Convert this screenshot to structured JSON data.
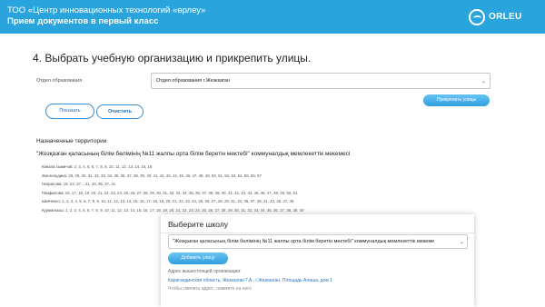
{
  "header": {
    "org": "ТОО «Центр инновационных технологий «өрлеу»",
    "subtitle": "Прием документов в первый класс",
    "logo_text": "ORLEU",
    "logo_icon": "orleu-logo-icon"
  },
  "step": {
    "title": "4. Выбрать учебную организацию и прикрепить улицы."
  },
  "form": {
    "edu_label": "Отдел образования",
    "edu_value": "Отдел образования г.Жезказган",
    "attach_button": "Прикрепить улицы",
    "show_button": "Показать",
    "clear_button": "Очистить"
  },
  "assigned": {
    "heading": "Назначенные территории",
    "school": "\"Жезқазған қаласының білім бөлімінің №11 жалпы орта білім беретін мектебі\" коммуналдық мемлекеттік мекемесі",
    "streets": [
      {
        "name": "Канала сымичов:",
        "numbers": "2, 3, 4, 5, 6, 7, 8, 9, 10, 11, 12, 13, 14, 15, 16"
      },
      {
        "name": "Жангельдина:",
        "numbers": "28, 29, 30, 31, 32, 33, 34, 35, 36, 37, 38, 39, 40, 41, 42, 43, 44, 45, 46, 47, 48, 49, 50, 51, 52, 53, 54, 55, 56, 57"
      },
      {
        "name": "Некрасова:",
        "numbers": "15, 22, 27, , 31, 33, 35, 37, 41"
      },
      {
        "name": "Панфилова:",
        "numbers": "16, 17, 18, 19, 20, 21, 22, 23, 24, 25, 26, 27, 28, 29, 30, 31, 32, 33, 34, 35, 36, 37, 38, 39, 40, 41, 42, 43, 44, 45, 46, 47, 48, 49, 50, 51"
      },
      {
        "name": "Шевченко:",
        "numbers": "1, 2, 3, 4, 5, 6, 7, 8, 9, 10, 11, 12, 13, 14, 15, 16, 17, 18, 19, 20, 21, 22, 23, 24, 25, 26, 27, 28, 29, 31, 33, 35, 37, 39, 41, 43, 45, 47, 49"
      },
      {
        "name": "Курмангазы:",
        "numbers": "1, 2, 3, 4, 5, 6, 7, 8, 9, 10, 11, 12, 13, 14, 15, 16, 17, 18, 19, 20, 21, 22, 23, 24, 25, 26, 27, 28, 29, 30, 31, 32, 33, 34, 35, 36, 37, 38, 39, 40"
      }
    ]
  },
  "card": {
    "title": "Выберите школу",
    "school_value": "\"Жезқазған қаласының білім бөлімінің №11 жалпы орта білім беретін мектебі\" коммуналдық мемлекеттік мекеме",
    "add_button": "Добавить улицу",
    "addr_label": "Адрес вышестоящей организации:",
    "addr_value": "Карагандинская область, Жезказган Г.А., г.Жезказган, Площадь Алаша, дом 1",
    "addr_hint": "Чтобы сменить адрес, нажмите на него"
  }
}
